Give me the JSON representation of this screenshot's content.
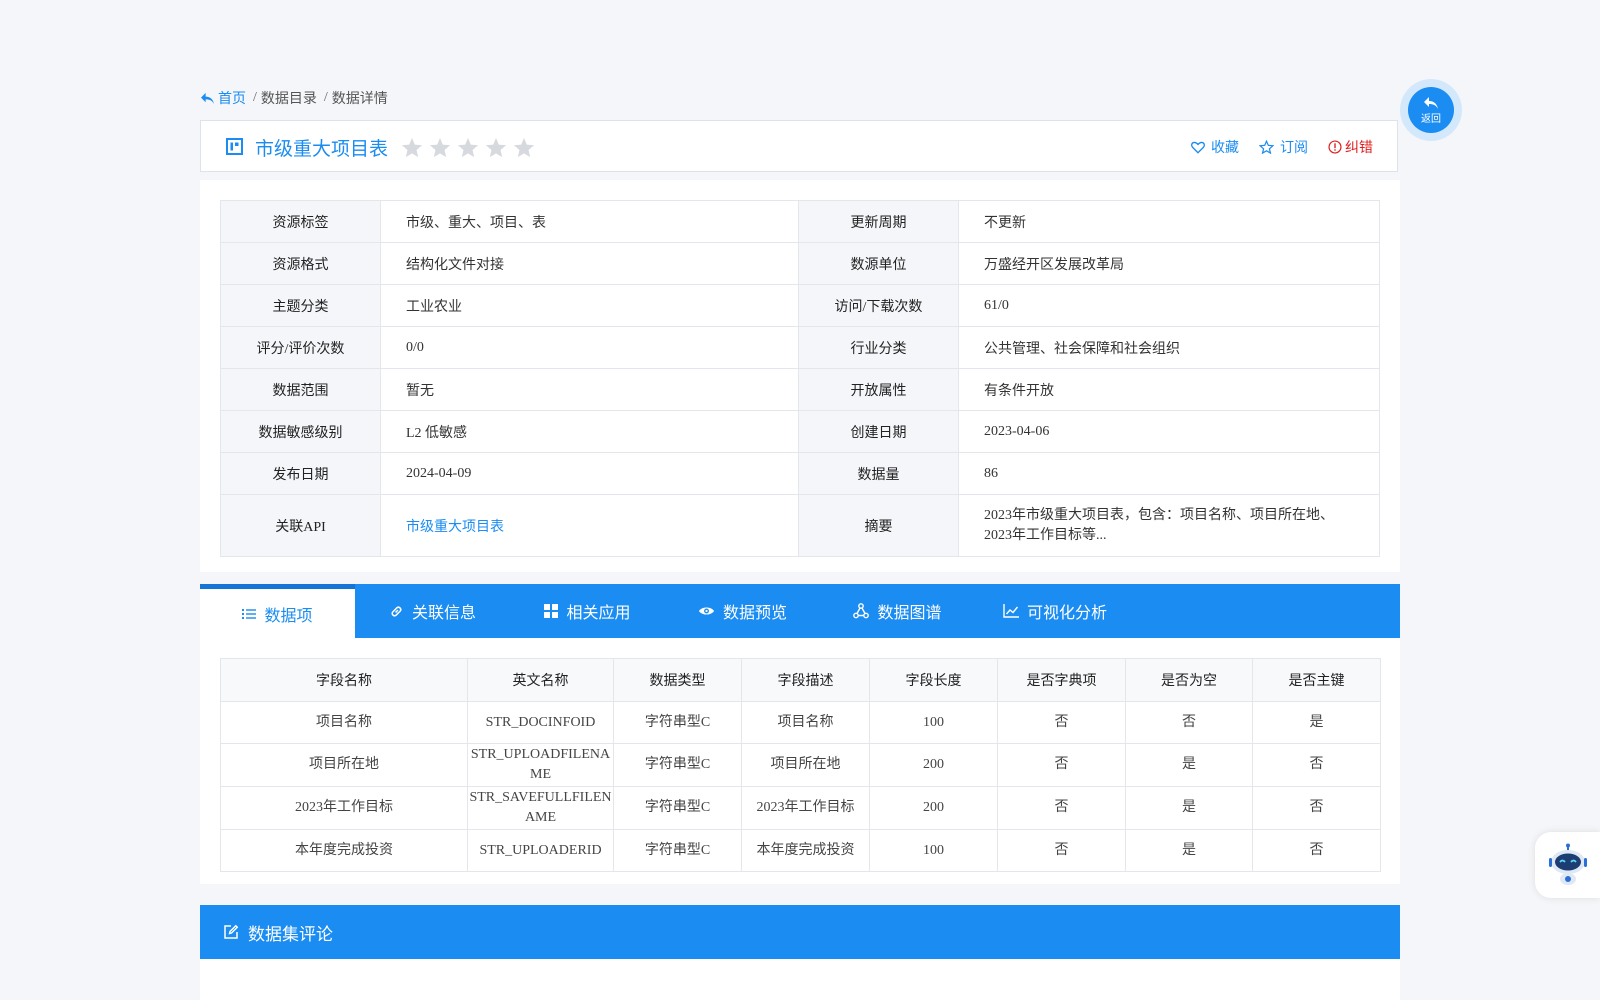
{
  "breadcrumb": {
    "home": "首页",
    "items": [
      "数据目录",
      "数据详情"
    ],
    "separator": "/"
  },
  "title": {
    "text": "市级重大项目表",
    "rating": 0,
    "max_rating": 5
  },
  "actions": {
    "favorite": "收藏",
    "subscribe": "订阅",
    "report": "纠错"
  },
  "back_button": {
    "label": "返回"
  },
  "info": {
    "rows": [
      [
        "资源标签",
        "市级、重大、项目、表",
        "更新周期",
        "不更新"
      ],
      [
        "资源格式",
        "结构化文件对接",
        "数源单位",
        "万盛经开区发展改革局"
      ],
      [
        "主题分类",
        "工业农业",
        "访问/下载次数",
        "61/0"
      ],
      [
        "评分/评价次数",
        "0/0",
        "行业分类",
        "公共管理、社会保障和社会组织"
      ],
      [
        "数据范围",
        "暂无",
        "开放属性",
        "有条件开放"
      ],
      [
        "数据敏感级别",
        "L2 低敏感",
        "创建日期",
        "2023-04-06"
      ],
      [
        "发布日期",
        "2024-04-09",
        "数据量",
        "86"
      ],
      [
        "关联API",
        "市级重大项目表",
        "摘要",
        "2023年市级重大项目表，包含：项目名称、项目所在地、2023年工作目标等..."
      ]
    ]
  },
  "tabs": [
    {
      "label": "数据项",
      "icon": "list-icon",
      "active": true
    },
    {
      "label": "关联信息",
      "icon": "link-icon",
      "active": false
    },
    {
      "label": "相关应用",
      "icon": "grid-icon",
      "active": false
    },
    {
      "label": "数据预览",
      "icon": "eye-icon",
      "active": false
    },
    {
      "label": "数据图谱",
      "icon": "graph-icon",
      "active": false
    },
    {
      "label": "可视化分析",
      "icon": "line-chart-icon",
      "active": false
    }
  ],
  "fields": {
    "headers": [
      "字段名称",
      "英文名称",
      "数据类型",
      "字段描述",
      "字段长度",
      "是否字典项",
      "是否为空",
      "是否主键"
    ],
    "rows": [
      [
        "项目名称",
        "STR_DOCINFOID",
        "字符串型C",
        "项目名称",
        "100",
        "否",
        "否",
        "是"
      ],
      [
        "项目所在地",
        "STR_UPLOADFILENAME",
        "字符串型C",
        "项目所在地",
        "200",
        "否",
        "是",
        "否"
      ],
      [
        "2023年工作目标",
        "STR_SAVEFULLFILENAME",
        "字符串型C",
        "2023年工作目标",
        "200",
        "否",
        "是",
        "否"
      ],
      [
        "本年度完成投资",
        "STR_UPLOADERID",
        "字符串型C",
        "本年度完成投资",
        "100",
        "否",
        "是",
        "否"
      ]
    ]
  },
  "comments": {
    "title": "数据集评论"
  },
  "colors": {
    "primary": "#1a8cf2",
    "primary_dark": "#1475d6",
    "danger": "#e02020",
    "star_inactive": "#d6d9de",
    "page_bg": "#f4f6f9"
  }
}
